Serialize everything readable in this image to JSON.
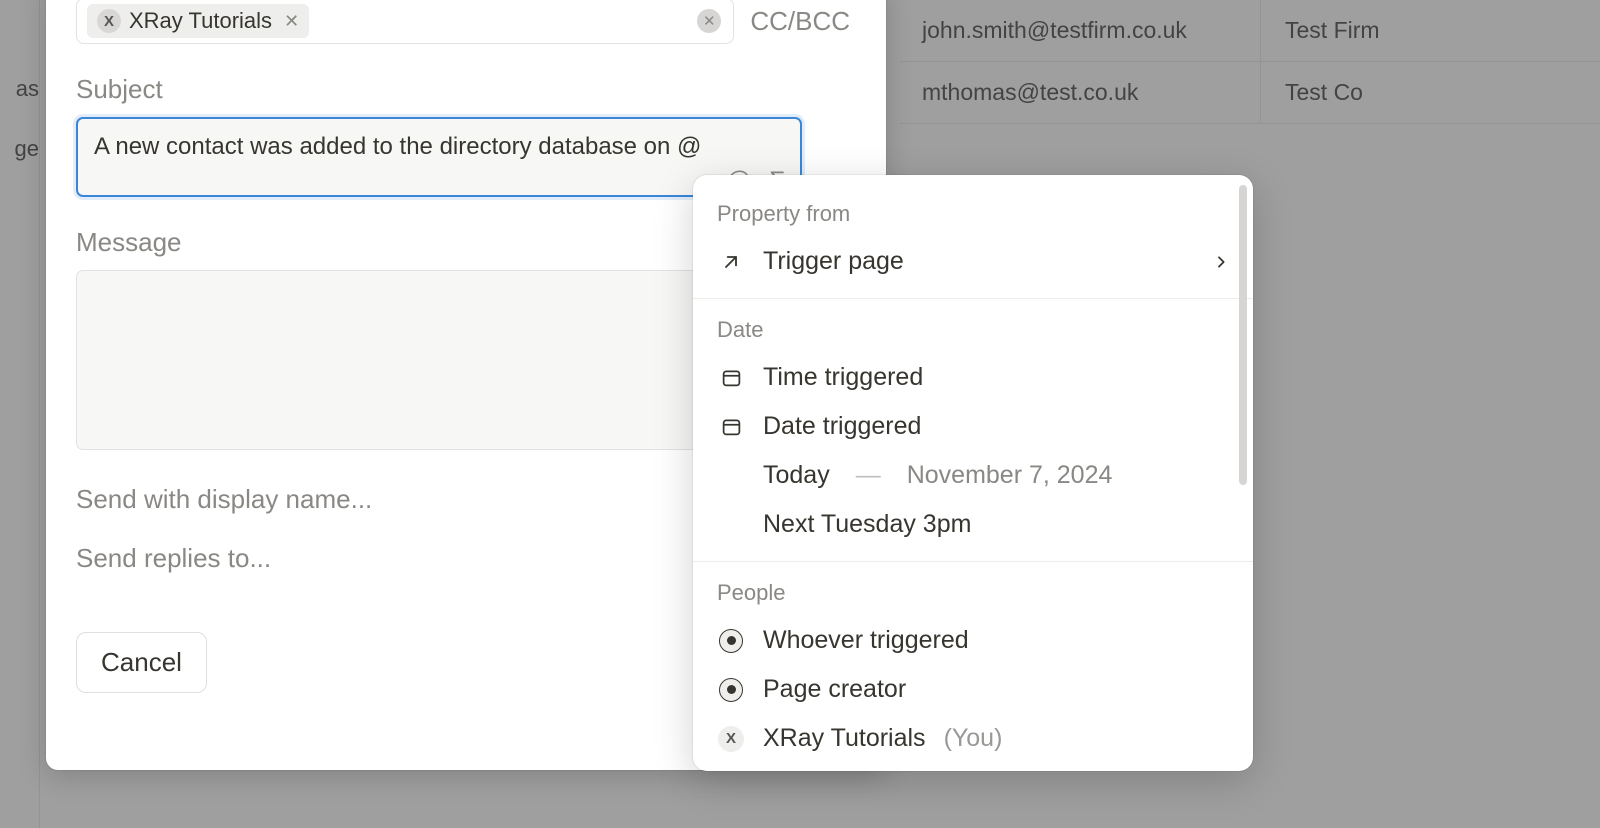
{
  "background": {
    "rows": [
      {
        "email": "john.smith@testfirm.co.uk",
        "firm": "Test Firm"
      },
      {
        "email": "mthomas@test.co.uk",
        "firm": "Test Co"
      }
    ],
    "left_strip": [
      "as",
      "ge"
    ]
  },
  "composer": {
    "recipient_chip": {
      "avatar_initial": "X",
      "label": "XRay Tutorials"
    },
    "ccbcc_label": "CC/BCC",
    "subject_label": "Subject",
    "subject_value": "A new contact was added to the directory database on @",
    "message_label": "Message",
    "display_name_link": "Send with display name...",
    "replies_link": "Send replies to...",
    "cancel_label": "Cancel"
  },
  "mention": {
    "section_property": "Property from",
    "trigger_page": "Trigger page",
    "section_date": "Date",
    "time_triggered": "Time triggered",
    "date_triggered": "Date triggered",
    "today_label": "Today",
    "today_date": "November 7, 2024",
    "next_tuesday": "Next Tuesday 3pm",
    "section_people": "People",
    "whoever": "Whoever triggered",
    "page_creator": "Page creator",
    "xray_name": "XRay Tutorials",
    "xray_you": "(You)",
    "xray_initial": "X"
  }
}
